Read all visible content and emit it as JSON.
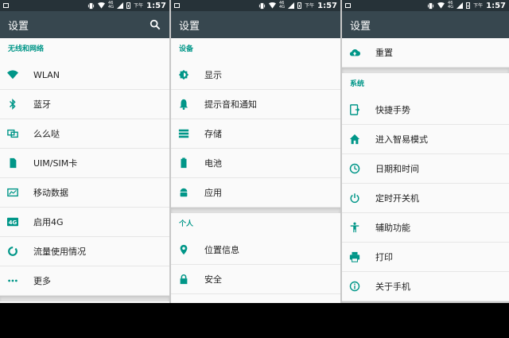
{
  "colors": {
    "statusbar": "#263238",
    "appbar": "#37474f",
    "accent": "#009688",
    "text": "#212121"
  },
  "status": {
    "time_prefix": "下午",
    "time": "1:57",
    "mini_top": "46",
    "mini_bottom": "4G"
  },
  "panels": [
    {
      "title": "设置",
      "sections": [
        {
          "header": "无线和网络",
          "items": [
            {
              "label": "WLAN",
              "icon": "wifi-icon"
            },
            {
              "label": "蓝牙",
              "icon": "bluetooth-icon"
            },
            {
              "label": "么么哒",
              "icon": "chat-bubbles-icon"
            },
            {
              "label": "UIM/SIM卡",
              "icon": "sim-card-icon"
            },
            {
              "label": "移动数据",
              "icon": "data-usage-icon"
            },
            {
              "label": "启用4G",
              "icon": "4g-icon"
            },
            {
              "label": "流量使用情况",
              "icon": "traffic-ring-icon"
            },
            {
              "label": "更多",
              "icon": "more-dots-icon"
            }
          ]
        }
      ]
    },
    {
      "title": "设置",
      "sections": [
        {
          "header": "设备",
          "items": [
            {
              "label": "显示",
              "icon": "brightness-icon"
            },
            {
              "label": "提示音和通知",
              "icon": "bell-icon"
            },
            {
              "label": "存储",
              "icon": "storage-icon"
            },
            {
              "label": "电池",
              "icon": "battery-icon"
            },
            {
              "label": "应用",
              "icon": "android-icon"
            }
          ]
        },
        {
          "header": "个人",
          "items": [
            {
              "label": "位置信息",
              "icon": "location-pin-icon"
            },
            {
              "label": "安全",
              "icon": "lock-icon"
            }
          ]
        }
      ]
    },
    {
      "title": "设置",
      "top_item": {
        "label": "重置",
        "icon": "cloud-upload-icon"
      },
      "sections": [
        {
          "header": "系统",
          "items": [
            {
              "label": "快捷手势",
              "icon": "gesture-icon"
            },
            {
              "label": "进入智易模式",
              "icon": "home-icon"
            },
            {
              "label": "日期和时间",
              "icon": "clock-icon"
            },
            {
              "label": "定时开关机",
              "icon": "power-icon"
            },
            {
              "label": "辅助功能",
              "icon": "accessibility-icon"
            },
            {
              "label": "打印",
              "icon": "printer-icon"
            },
            {
              "label": "关于手机",
              "icon": "info-icon"
            }
          ]
        }
      ]
    }
  ]
}
